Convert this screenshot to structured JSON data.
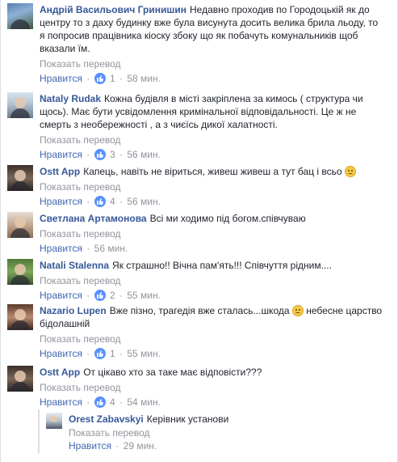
{
  "labels": {
    "translate": "Показать перевод",
    "like": "Нравится",
    "separator": "·"
  },
  "comments": [
    {
      "author": "Андрій Васильович Гринишин",
      "text": "Недавно проходив по Городоцькій як до центру то з даху будинку вже була висунута досить велика брила льоду, то я попросив працівника кіоску збоку що як побачуть комунальників щоб вказали їм.",
      "likes": "1",
      "time": "58 мин."
    },
    {
      "author": "Nataly Rudak",
      "text": "Кожна будівля в місті закріплена за кимось ( структура чи щось). Має бути усвідомлення кримінальної відповідальності. Це ж не смерть з необережності , а з чиєїсь дикої халатності.",
      "likes": "3",
      "time": "56 мин."
    },
    {
      "author": "Ostt App",
      "text": "Капець, навіть не віриться, живеш живеш а тут бац і всьо",
      "emoji": "sad-face",
      "likes": "4",
      "time": "56 мин."
    },
    {
      "author": "Светлана Артамонова",
      "text": "Всі ми ходимо під богом.співчуваю",
      "likes": "",
      "time": "56 мин."
    },
    {
      "author": "Natali Stalenna",
      "text": "Як страшно!! Вічна пам'ять!!! Співчуття рідним....",
      "likes": "2",
      "time": "55 мин."
    },
    {
      "author": "Nazario Lupen",
      "text": "Вже пізно, трагедія вже сталась...шкода",
      "emoji": "sad-face",
      "text_after": "небесне царство бідолашній",
      "likes": "1",
      "time": "55 мин."
    },
    {
      "author": "Ostt App",
      "text": "От цікаво хто за таке має відповісти???",
      "likes": "4",
      "time": "54 мин."
    }
  ],
  "reply": {
    "author": "Orest Zabavskyi",
    "text": "Керівник установи",
    "time": "29 мин."
  },
  "colors": {
    "author": "#365899",
    "meta": "#90949c",
    "like_link": "#4267b2",
    "like_badge": "#5890ff"
  }
}
